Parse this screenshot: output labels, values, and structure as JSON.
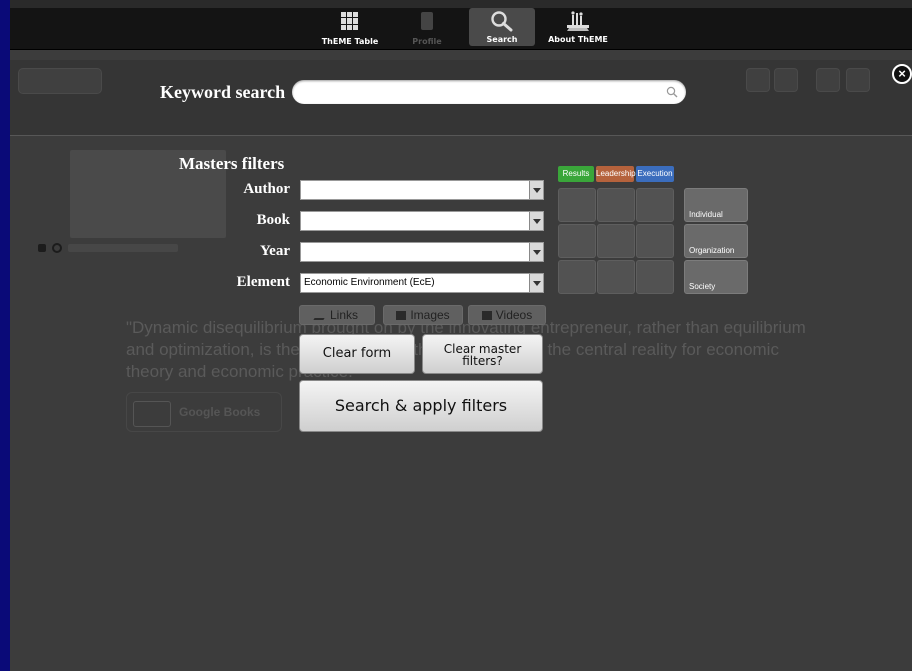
{
  "tabs": [
    {
      "label": "ThEME Table",
      "icon": "grid-icon",
      "state": "normal"
    },
    {
      "label": "Profile",
      "icon": "profile-icon",
      "state": "disabled"
    },
    {
      "label": "Search",
      "icon": "search-icon",
      "state": "active"
    },
    {
      "label": "About ThEME",
      "icon": "about-icon",
      "state": "normal"
    }
  ],
  "keyword_search": {
    "label": "Keyword search",
    "value": "",
    "placeholder": ""
  },
  "close_symbol": "×",
  "masters": {
    "title": "Masters filters",
    "author_label": "Author",
    "author_value": "",
    "book_label": "Book",
    "book_value": "",
    "year_label": "Year",
    "year_value": "",
    "element_label": "Element",
    "element_value": "Economic Environment (EcE)"
  },
  "media": {
    "links": "Links",
    "images": "Images",
    "videos": "Videos"
  },
  "buttons": {
    "clear_form": "Clear form",
    "clear_master_line1": "Clear master",
    "clear_master_line2": "filters?",
    "search_apply": "Search & apply filters"
  },
  "matrix": {
    "columns": [
      {
        "label": "Results",
        "color": "#3aa63a"
      },
      {
        "label": "Leadership",
        "color": "#b5623c"
      },
      {
        "label": "Execution",
        "color": "#3b6dbd"
      }
    ],
    "rows": [
      "Individual",
      "Organization",
      "Society"
    ]
  },
  "background": {
    "quote": "\"Dynamic disequilibrium brought on by the innovating entrepreneur, rather than equilibrium and optimization, is the norm of a healthy economy and the central reality for economic theory and economic practice.\"",
    "google_books": "Google Books"
  },
  "colors": {
    "desktop": "#0a0a78",
    "panel": "#3c3c3c",
    "tabbar": "#141414"
  }
}
